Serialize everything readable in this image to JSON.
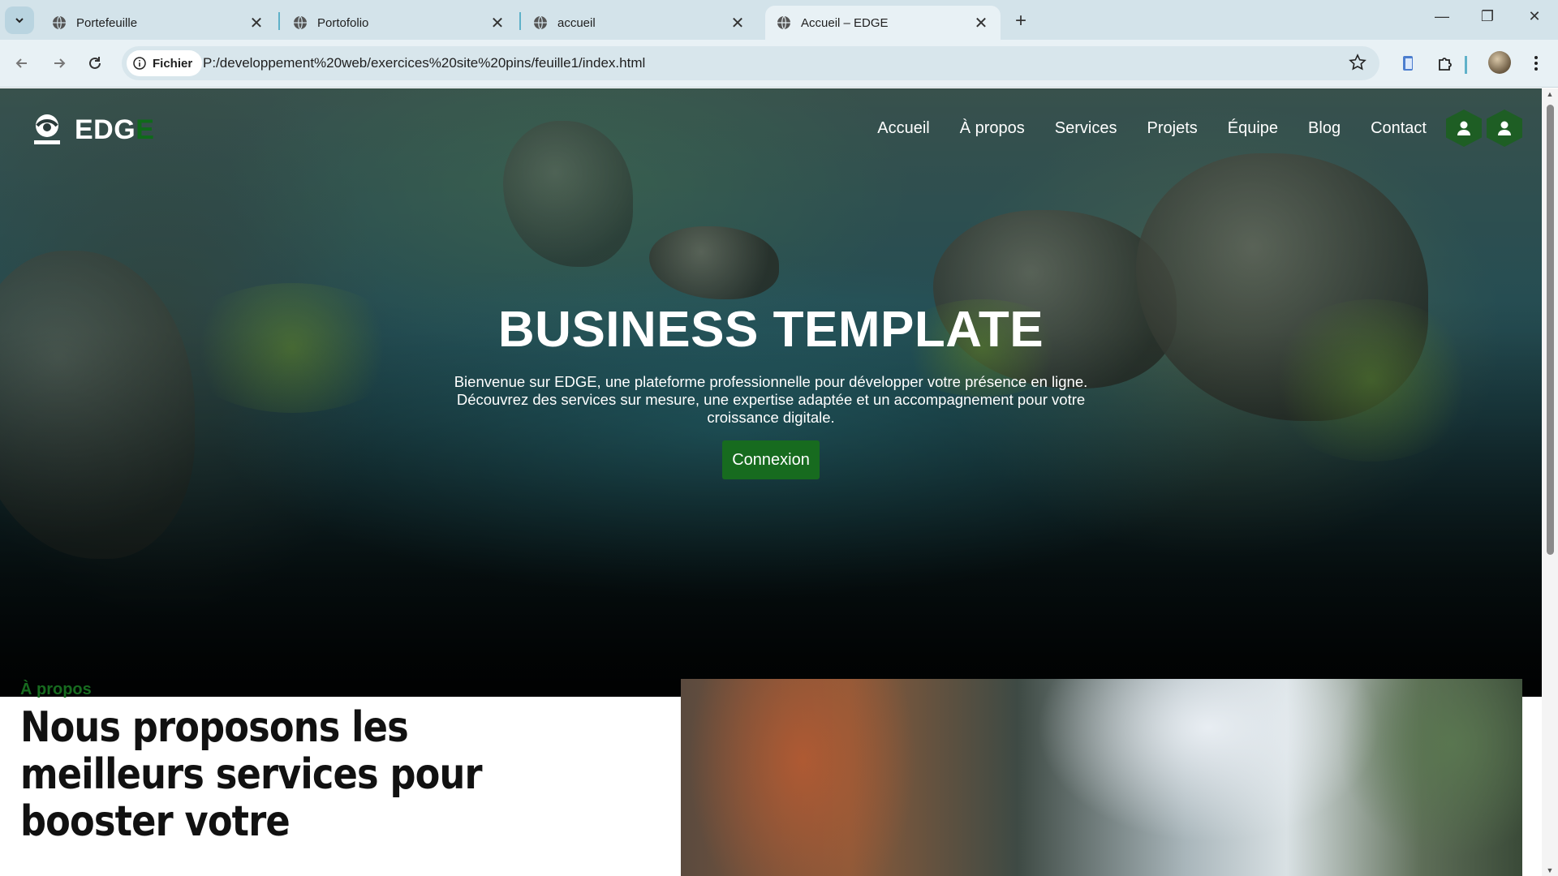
{
  "browser": {
    "tabs": [
      {
        "title": "Portefeuille",
        "active": false
      },
      {
        "title": "Portofolio",
        "active": false
      },
      {
        "title": "accueil",
        "active": false
      },
      {
        "title": "Accueil – EDGE",
        "active": true
      }
    ],
    "address": {
      "chip_label": "Fichier",
      "url": "P:/developpement%20web/exercices%20site%20pins/feuille1/index.html"
    }
  },
  "site": {
    "logo": {
      "text_main": "EDG",
      "text_accent": "E",
      "accent_color": "#0f6a1a"
    },
    "nav": [
      "Accueil",
      "À propos",
      "Services",
      "Projets",
      "Équipe",
      "Blog",
      "Contact"
    ],
    "brand_color": "#176b1f"
  },
  "hero": {
    "title": "BUSINESS TEMPLATE",
    "subtitle": "Bienvenue sur EDGE, une plateforme professionnelle pour développer votre présence en ligne. Découvrez des services sur mesure, une expertise adaptée et un accompagnement pour votre croissance digitale.",
    "button_label": "Connexion"
  },
  "about": {
    "kicker": "À propos",
    "heading": "Nous proposons les meilleurs services pour booster votre"
  }
}
